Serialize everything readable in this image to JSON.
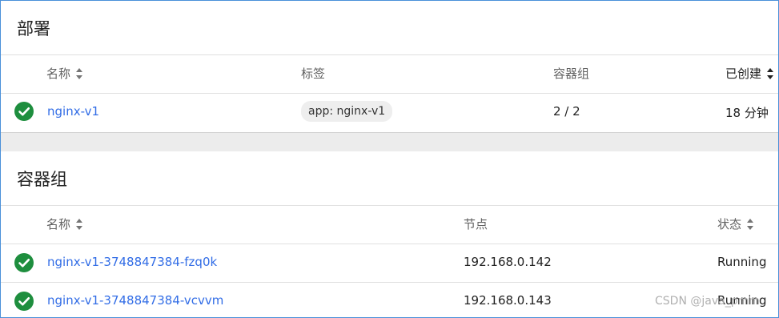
{
  "deployments": {
    "title": "部署",
    "columns": {
      "name": "名称",
      "labels": "标签",
      "pods": "容器组",
      "created": "已创建"
    },
    "rows": [
      {
        "name": "nginx-v1",
        "label": "app: nginx-v1",
        "pods": "2 / 2",
        "created": "18 分钟",
        "status": "ok"
      }
    ]
  },
  "pods": {
    "title": "容器组",
    "columns": {
      "name": "名称",
      "node": "节点",
      "status": "状态"
    },
    "rows": [
      {
        "name": "nginx-v1-3748847384-fzq0k",
        "node": "192.168.0.142",
        "status": "Running"
      },
      {
        "name": "nginx-v1-3748847384-vcvvm",
        "node": "192.168.0.143",
        "status": "Running"
      }
    ]
  },
  "colors": {
    "link": "#326de6",
    "success": "#1e8e3e"
  },
  "watermark": "CSDN @java_pmm"
}
